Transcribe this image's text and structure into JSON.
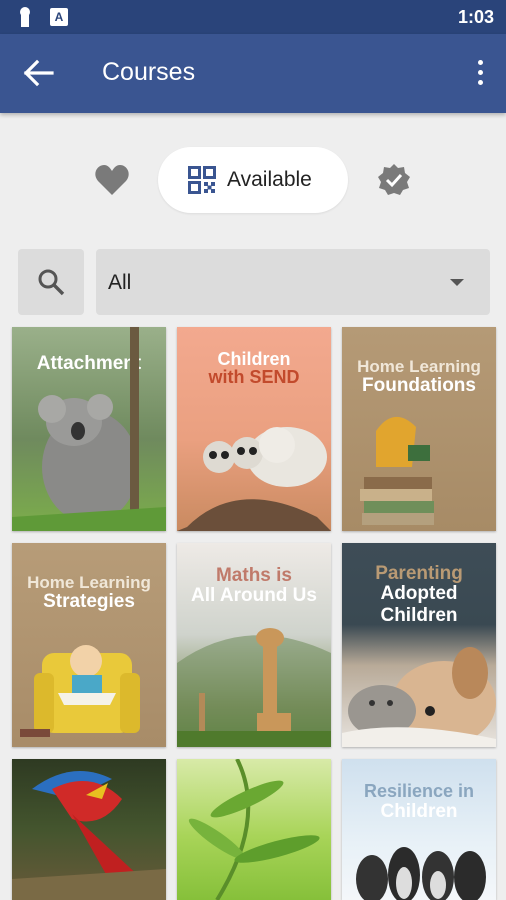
{
  "status_bar": {
    "time": "1:03"
  },
  "app_bar": {
    "title": "Courses"
  },
  "segments": {
    "selected_label": "Available"
  },
  "filter": {
    "selected": "All"
  },
  "courses": [
    {
      "line1": "Attachment",
      "line2": ""
    },
    {
      "line1": "Children",
      "line2": "with SEND"
    },
    {
      "line1": "Home Learning",
      "line2": "Foundations"
    },
    {
      "line1": "Home Learning",
      "line2": "Strategies"
    },
    {
      "line1": "Maths is",
      "line2": "All Around Us"
    },
    {
      "line1": "Parenting",
      "line2": "Adopted Children"
    },
    {
      "line1": "",
      "line2": ""
    },
    {
      "line1": "",
      "line2": ""
    },
    {
      "line1": "Resilience in",
      "line2": "Children"
    }
  ],
  "colors": {
    "status_bar": "#2a447a",
    "app_bar": "#3a5591",
    "background": "#eeeeee",
    "accent_blue": "#3a5591"
  }
}
